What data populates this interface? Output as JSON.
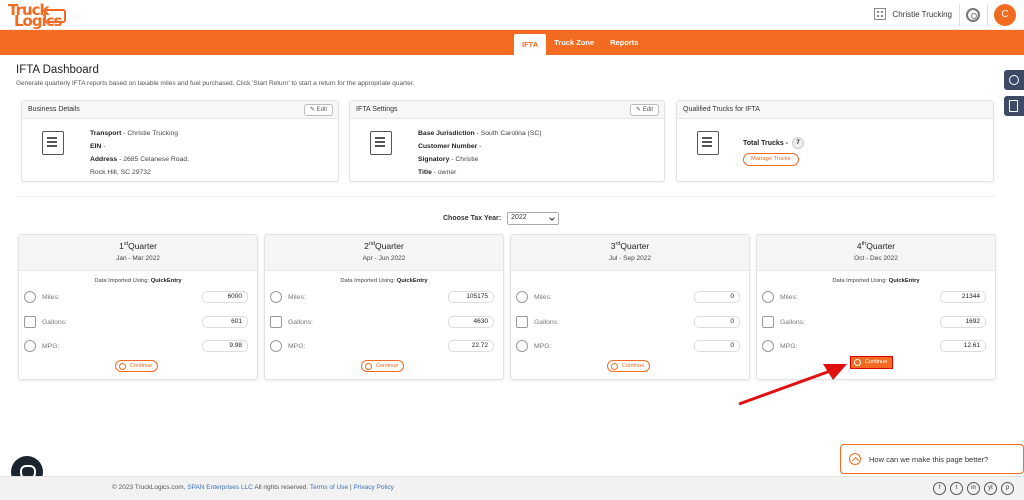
{
  "header": {
    "logo_line1": "Truck",
    "logo_line2": "Logics",
    "company_name": "Christie Trucking",
    "avatar_letter": "C"
  },
  "nav": {
    "tabs": [
      {
        "label": "IFTA",
        "active": true
      },
      {
        "label": "Truck Zone",
        "active": false
      },
      {
        "label": "Reports",
        "active": false
      }
    ]
  },
  "page": {
    "title": "IFTA Dashboard",
    "subtitle": "Generate quarterly IFTA reports based on taxable miles and fuel purchased. Click 'Start Return' to start a return for the appropriate quarter."
  },
  "business": {
    "heading": "Business Details",
    "edit_label": "Edit",
    "transport_label": "Transport",
    "transport_value": " - Christie Trucking",
    "ein_label": "EIN",
    "ein_value": " -",
    "address_label": "Address",
    "address_line1": " - 2685 Celanese Road,",
    "address_line2": "Rock Hill, SC 29732"
  },
  "settings": {
    "heading": "IFTA Settings",
    "edit_label": "Edit",
    "jurisdiction_label": "Base Jurisdiction",
    "jurisdiction_value": " - South Carolina (SC)",
    "customer_label": "Customer Number",
    "customer_value": " -",
    "signatory_label": "Signatory",
    "signatory_value": " - Christie",
    "title_label": "Title",
    "title_value": " - owner"
  },
  "trucks": {
    "heading": "Qualified Trucks for IFTA",
    "total_label": "Total Trucks -",
    "total_value": "7",
    "manage_label": "Manage Trucks"
  },
  "tax_year": {
    "label": "Choose Tax Year:",
    "value": "2022"
  },
  "quarters": [
    {
      "num": "1",
      "sup": "st",
      "word": "Quarter",
      "range": "Jan - Mar 2022",
      "imported": true,
      "miles": "6000",
      "gallons": "601",
      "mpg": "9.98",
      "highlight": false
    },
    {
      "num": "2",
      "sup": "nd",
      "word": "Quarter",
      "range": "Apr - Jun 2022",
      "imported": true,
      "miles": "105175",
      "gallons": "4630",
      "mpg": "22.72",
      "highlight": false
    },
    {
      "num": "3",
      "sup": "rd",
      "word": "Quarter",
      "range": "Jul - Sep 2022",
      "imported": false,
      "miles": "0",
      "gallons": "0",
      "mpg": "0",
      "highlight": false
    },
    {
      "num": "4",
      "sup": "th",
      "word": "Quarter",
      "range": "Oct - Dec 2022",
      "imported": true,
      "miles": "21344",
      "gallons": "1692",
      "mpg": "12.61",
      "highlight": true
    }
  ],
  "quarter_labels": {
    "imported_prefix": "Data Imported Using: ",
    "imported_source": "QuickEntry",
    "miles": "Miles:",
    "gallons": "Gallons:",
    "mpg": "MPG:",
    "continue": "Continue"
  },
  "feedback": {
    "text": "How can we make this page better?"
  },
  "footer": {
    "copyright": "© 2023 TruckLogics.com, ",
    "span_link": "SPAN Enterprises LLC",
    "rights": " All rights reserved. ",
    "terms": "Terms of Use",
    "divider": " | ",
    "privacy": "Privacy Policy",
    "socials": [
      "f",
      "t",
      "in",
      "yt",
      "p"
    ]
  },
  "colors": {
    "brand": "#f26b21",
    "side_buttons": "#3d4a66",
    "arrow": "#e01010"
  }
}
